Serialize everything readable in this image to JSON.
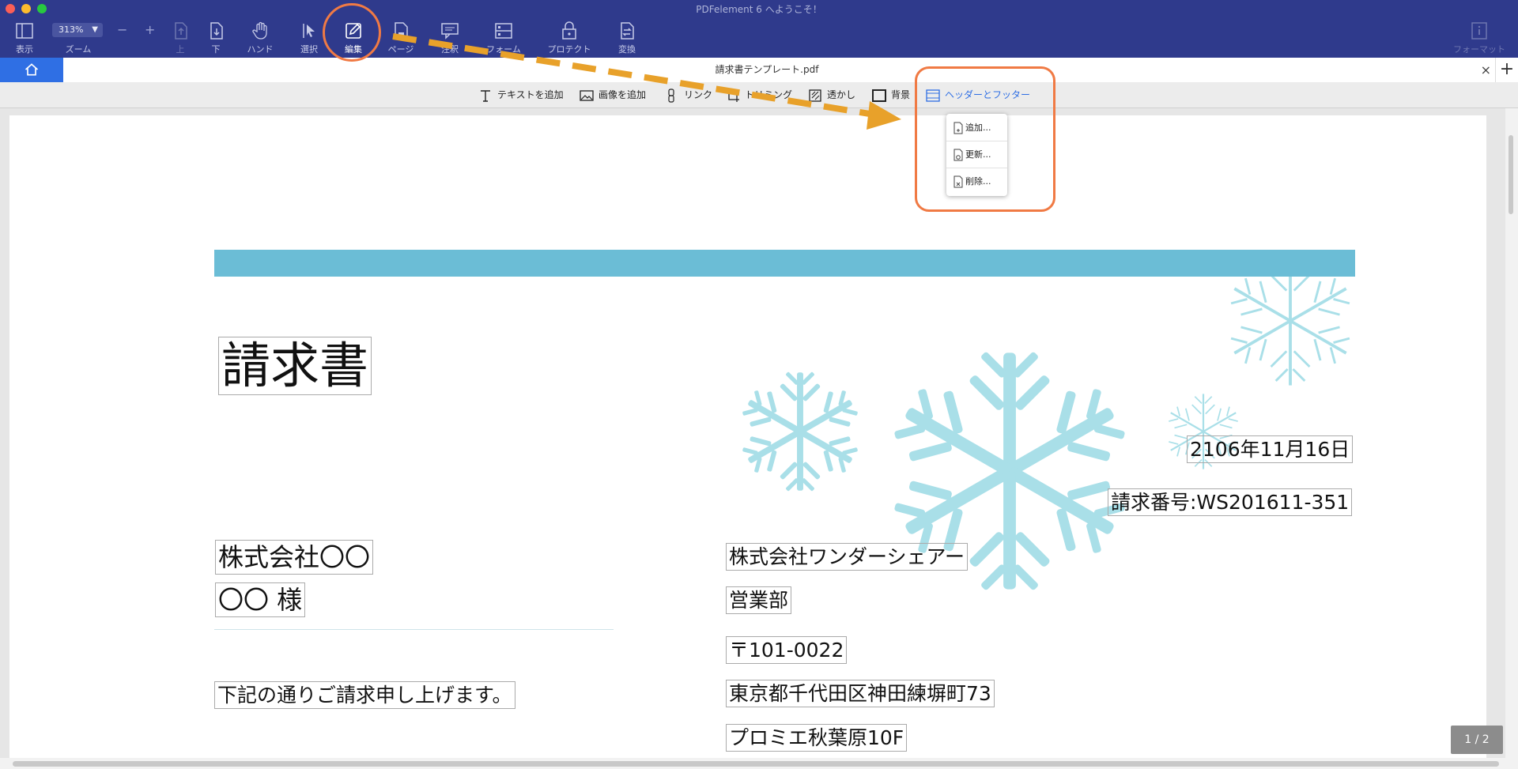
{
  "window": {
    "title": "PDFelement 6 へようこそ！"
  },
  "toolbar": {
    "view": "表示",
    "zoom": "ズーム",
    "zoom_value": "313%",
    "zoom_minus": "−",
    "zoom_plus": "+",
    "up": "上",
    "down": "下",
    "hand": "ハンド",
    "select": "選択",
    "edit": "編集",
    "page": "ページ",
    "comment": "注釈",
    "form": "フォーム",
    "protect": "プロテクト",
    "convert": "変換",
    "format": "フォーマット"
  },
  "tab": {
    "title": "請求書テンプレート.pdf",
    "close": "×",
    "add": "+"
  },
  "edit_tools": {
    "add_text": "テキストを追加",
    "add_image": "画像を追加",
    "link": "リンク",
    "crop": "トリミング",
    "watermark": "透かし",
    "background": "背景",
    "header_footer": "ヘッダーとフッター"
  },
  "dropdown": {
    "items": [
      "追加...",
      "更新...",
      "削除..."
    ]
  },
  "document": {
    "title": "請求書",
    "date": "2106年11月16日",
    "invoice_number": "請求番号:WS201611-351",
    "client_company": "株式会社〇〇",
    "client_name": "〇〇 様",
    "message": "下記の通りご請求申し上げます。",
    "sender_company": "株式会社ワンダーシェアー",
    "department": "営業部",
    "postal": "〒101-0022",
    "address1": "東京都千代田区神田練塀町73",
    "address2": "プロミエ秋葉原10F"
  },
  "page_indicator": "1 / 2",
  "colors": {
    "toolbar_bg": "#2f3a8c",
    "accent": "#2f6fe4",
    "annotation": "#f07a44",
    "arrow": "#e8a12a",
    "band": "#6bbdd6",
    "snowflake": "#a9dfe8"
  }
}
